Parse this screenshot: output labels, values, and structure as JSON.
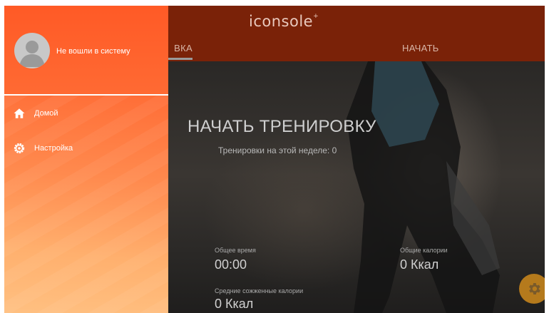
{
  "app": {
    "logo_text": "iconsole",
    "logo_mark": "+"
  },
  "tabs": [
    {
      "label": "ВКА"
    },
    {
      "label": "НАЧАТЬ"
    }
  ],
  "hero": {
    "title": "НАЧАТЬ ТРЕНИРОВКУ",
    "subtitle": "Тренировки на этой неделе: 0"
  },
  "stats": {
    "total_time_label": "Общее время",
    "total_time_value": "00:00",
    "total_calories_label": "Общие калории",
    "total_calories_value": "0 Ккал",
    "avg_burned_label": "Средние сожженные калории",
    "avg_burned_value": "0 Ккал"
  },
  "drawer": {
    "login_status": "Не вошли в систему",
    "items": [
      {
        "label": "Домой",
        "icon": "home-icon"
      },
      {
        "label": "Настройка",
        "icon": "settings-icon"
      }
    ]
  },
  "colors": {
    "drawer_top": "#ff5d2b",
    "drawer_bottom": "#ffc081",
    "topbar": "#7a2208",
    "fab": "#b57a1c"
  }
}
